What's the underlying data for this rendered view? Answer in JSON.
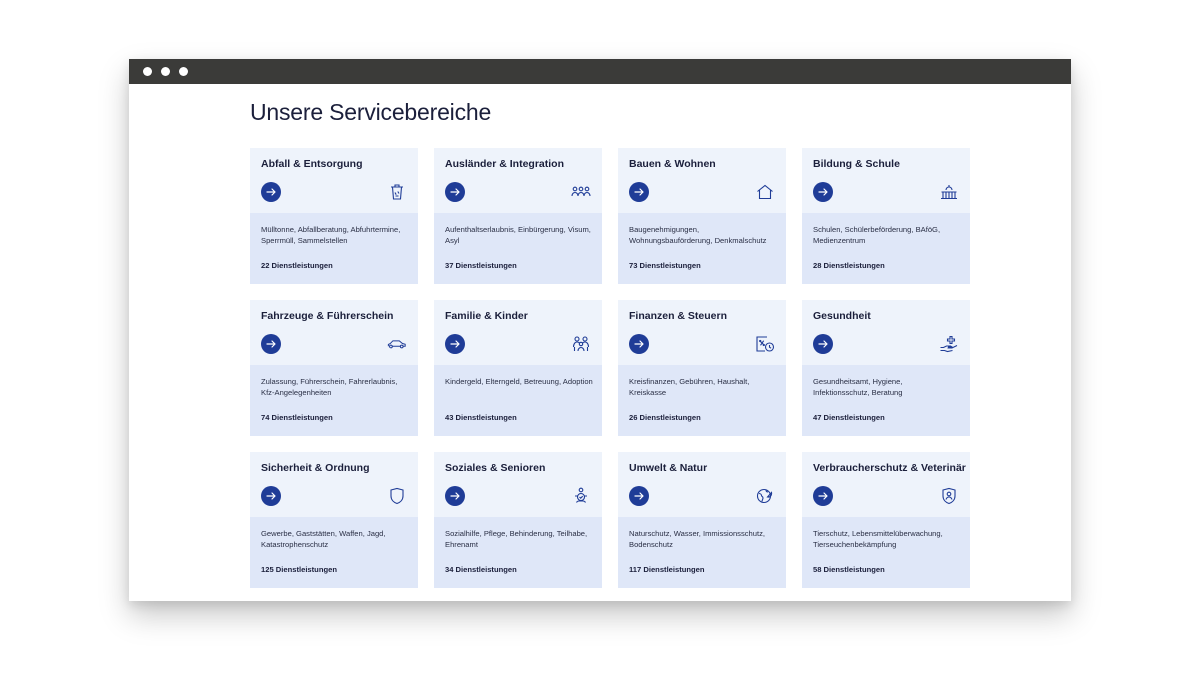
{
  "page": {
    "title": "Unsere Servicebereiche"
  },
  "cards": [
    {
      "title": "Abfall & Entsorgung",
      "icon": "trash-bin-icon",
      "description": "Mülltonne, Abfallberatung, Abfuhrtermine, Sperrmüll, Sammelstellen",
      "count": "22 Dienstleistungen"
    },
    {
      "title": "Ausländer & Integration",
      "icon": "people-group-icon",
      "description": "Aufenthaltserlaubnis, Einbürgerung, Visum, Asyl",
      "count": "37 Dienstleistungen"
    },
    {
      "title": "Bauen & Wohnen",
      "icon": "house-icon",
      "description": "Baugenehmigungen, Wohnungsbauförderung, Denkmalschutz",
      "count": "73 Dienstleistungen"
    },
    {
      "title": "Bildung & Schule",
      "icon": "school-building-icon",
      "description": "Schulen, Schülerbeförderung, BAföG, Medienzentrum",
      "count": "28 Dienstleistungen"
    },
    {
      "title": "Fahrzeuge & Führerschein",
      "icon": "car-icon",
      "description": "Zulassung, Führerschein, Fahrerlaubnis, Kfz-Angelegenheiten",
      "count": "74 Dienstleistungen"
    },
    {
      "title": "Familie & Kinder",
      "icon": "family-icon",
      "description": "Kindergeld, Elterngeld, Betreuung, Adoption",
      "count": "43 Dienstleistungen"
    },
    {
      "title": "Finanzen & Steuern",
      "icon": "tax-document-icon",
      "description": "Kreisfinanzen, Gebühren, Haushalt, Kreiskasse",
      "count": "26 Dienstleistungen"
    },
    {
      "title": "Gesundheit",
      "icon": "health-hand-icon",
      "description": "Gesundheitsamt, Hygiene, Infektionsschutz, Beratung",
      "count": "47 Dienstleistungen"
    },
    {
      "title": "Sicherheit & Ordnung",
      "icon": "shield-icon",
      "description": "Gewerbe, Gaststätten, Waffen, Jagd, Katastrophenschutz",
      "count": "125 Dienstleistungen"
    },
    {
      "title": "Soziales & Senioren",
      "icon": "social-care-icon",
      "description": "Sozialhilfe, Pflege, Behinderung, Teilhabe, Ehrenamt",
      "count": "34 Dienstleistungen"
    },
    {
      "title": "Umwelt & Natur",
      "icon": "globe-leaf-icon",
      "description": "Naturschutz, Wasser, Immissionsschutz, Bodenschutz",
      "count": "117 Dienstleistungen"
    },
    {
      "title": "Verbraucherschutz & Veterinär",
      "icon": "consumer-shield-icon",
      "description": "Tierschutz, Lebensmittelüberwachung, Tierseuchenbekämpfung",
      "count": "58 Dienstleistungen"
    }
  ],
  "colors": {
    "accent": "#1f3c97",
    "card_top": "#eef3fb",
    "card_bottom": "#dfe7f8",
    "titlebar": "#3b3b39"
  }
}
